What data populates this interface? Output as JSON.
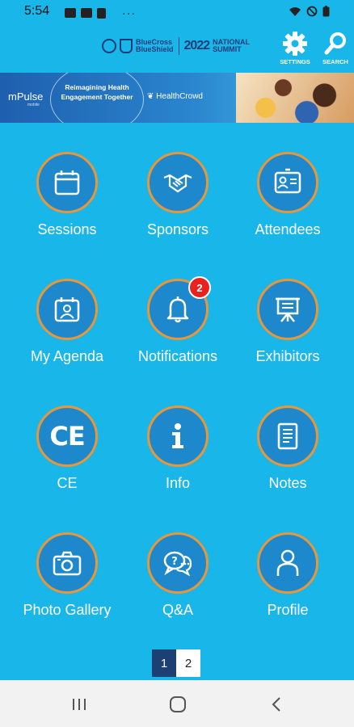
{
  "status_bar": {
    "time": "5:54",
    "more": "···"
  },
  "header": {
    "brand_line1": "BlueCross",
    "brand_line2": "BlueShield",
    "brand_year": "2022",
    "brand_summit_line1": "NATIONAL",
    "brand_summit_line2": "SUMMIT",
    "settings_label": "SETTINGS",
    "search_label": "SEARCH"
  },
  "banner": {
    "mpulse": "mPulse",
    "mpulse_sub": "mobile",
    "headline": "Reimagining Health Engagement Together",
    "partner": "HealthCrowd"
  },
  "tiles": [
    {
      "label": "Sessions",
      "icon": "calendar-icon"
    },
    {
      "label": "Sponsors",
      "icon": "handshake-icon"
    },
    {
      "label": "Attendees",
      "icon": "id-card-icon"
    },
    {
      "label": "My Agenda",
      "icon": "agenda-person-icon"
    },
    {
      "label": "Notifications",
      "icon": "bell-icon",
      "badge": "2"
    },
    {
      "label": "Exhibitors",
      "icon": "presentation-board-icon"
    },
    {
      "label": "CE",
      "icon": "ce-text-icon",
      "icon_text": "CE"
    },
    {
      "label": "Info",
      "icon": "info-icon"
    },
    {
      "label": "Notes",
      "icon": "notes-icon"
    },
    {
      "label": "Photo Gallery",
      "icon": "camera-icon"
    },
    {
      "label": "Q&A",
      "icon": "chat-question-icon"
    },
    {
      "label": "Profile",
      "icon": "person-icon"
    }
  ],
  "pagination": {
    "pages": [
      "1",
      "2"
    ],
    "current": "1"
  },
  "colors": {
    "background": "#19b6ea",
    "tile_fill": "#1e88cc",
    "tile_ring": "#e8963a",
    "badge": "#e8231f",
    "active_page": "#1c3f74"
  }
}
